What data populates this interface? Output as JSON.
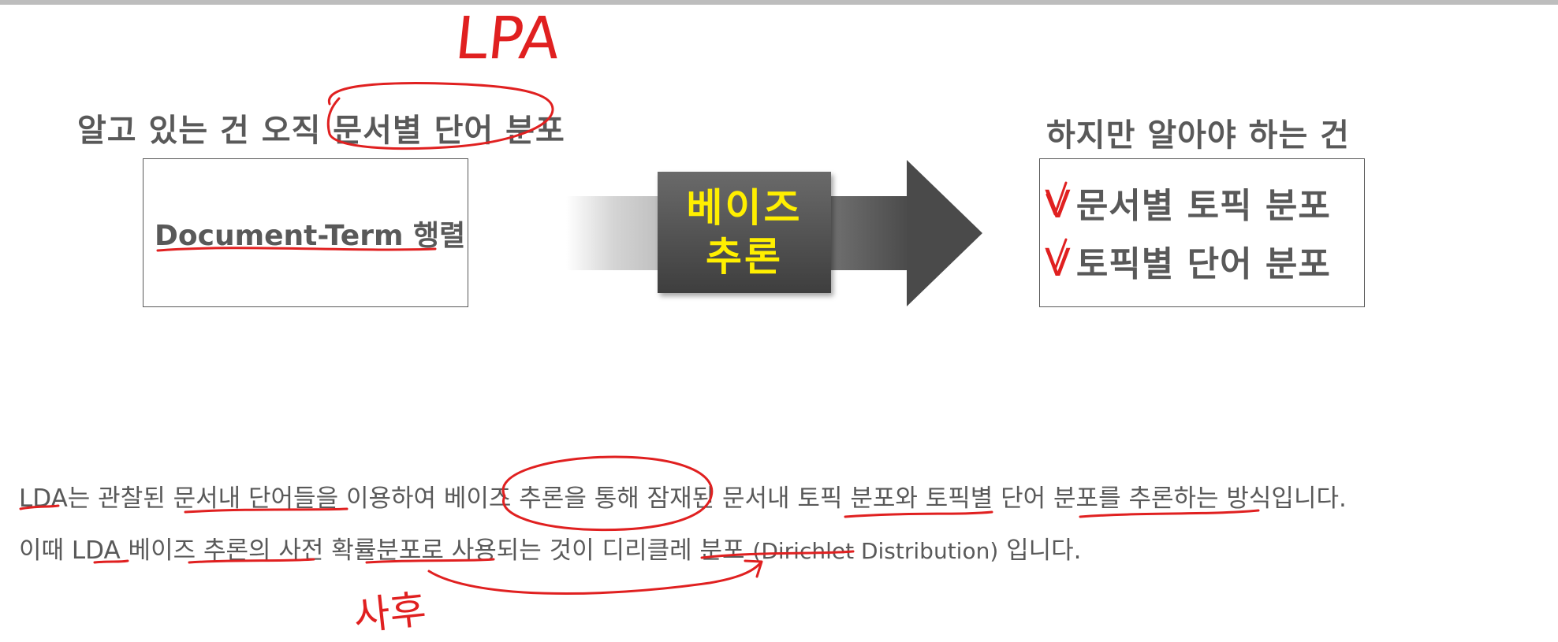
{
  "diagram": {
    "left_heading": "알고 있는 건 오직 문서별 단어 분포",
    "left_box_text": "Document-Term 행렬",
    "arrow_label_line1": "베이즈",
    "arrow_label_line2": "추론",
    "right_heading": "하지만 알아야 하는 건",
    "right_items": [
      "문서별 토픽 분포",
      "토픽별 단어 분포"
    ],
    "check_mark": "V"
  },
  "paragraph": {
    "line1": {
      "p1": "LDA는 관찰된 문서내 단어들을 이용하여 베이즈 추론을 통해 잠재된 문서내 토픽 분포와 토픽별 단어 분포를 추론하는 방식입니다."
    },
    "line2": {
      "p1": "이때 LDA 베이즈 추론의 사전 확률분포로 사용되는 것이 디리클레 분포 ",
      "p2": "(Dirichlet Distribution)",
      "p3": " 입니다."
    }
  },
  "annotations": {
    "top_label": "LPA",
    "bottom_label": "사후"
  },
  "colors": {
    "text": "#595959",
    "arrow_label": "#ffef00",
    "annotation": "#e02020",
    "arrow_dark": "#4a4a4a"
  }
}
